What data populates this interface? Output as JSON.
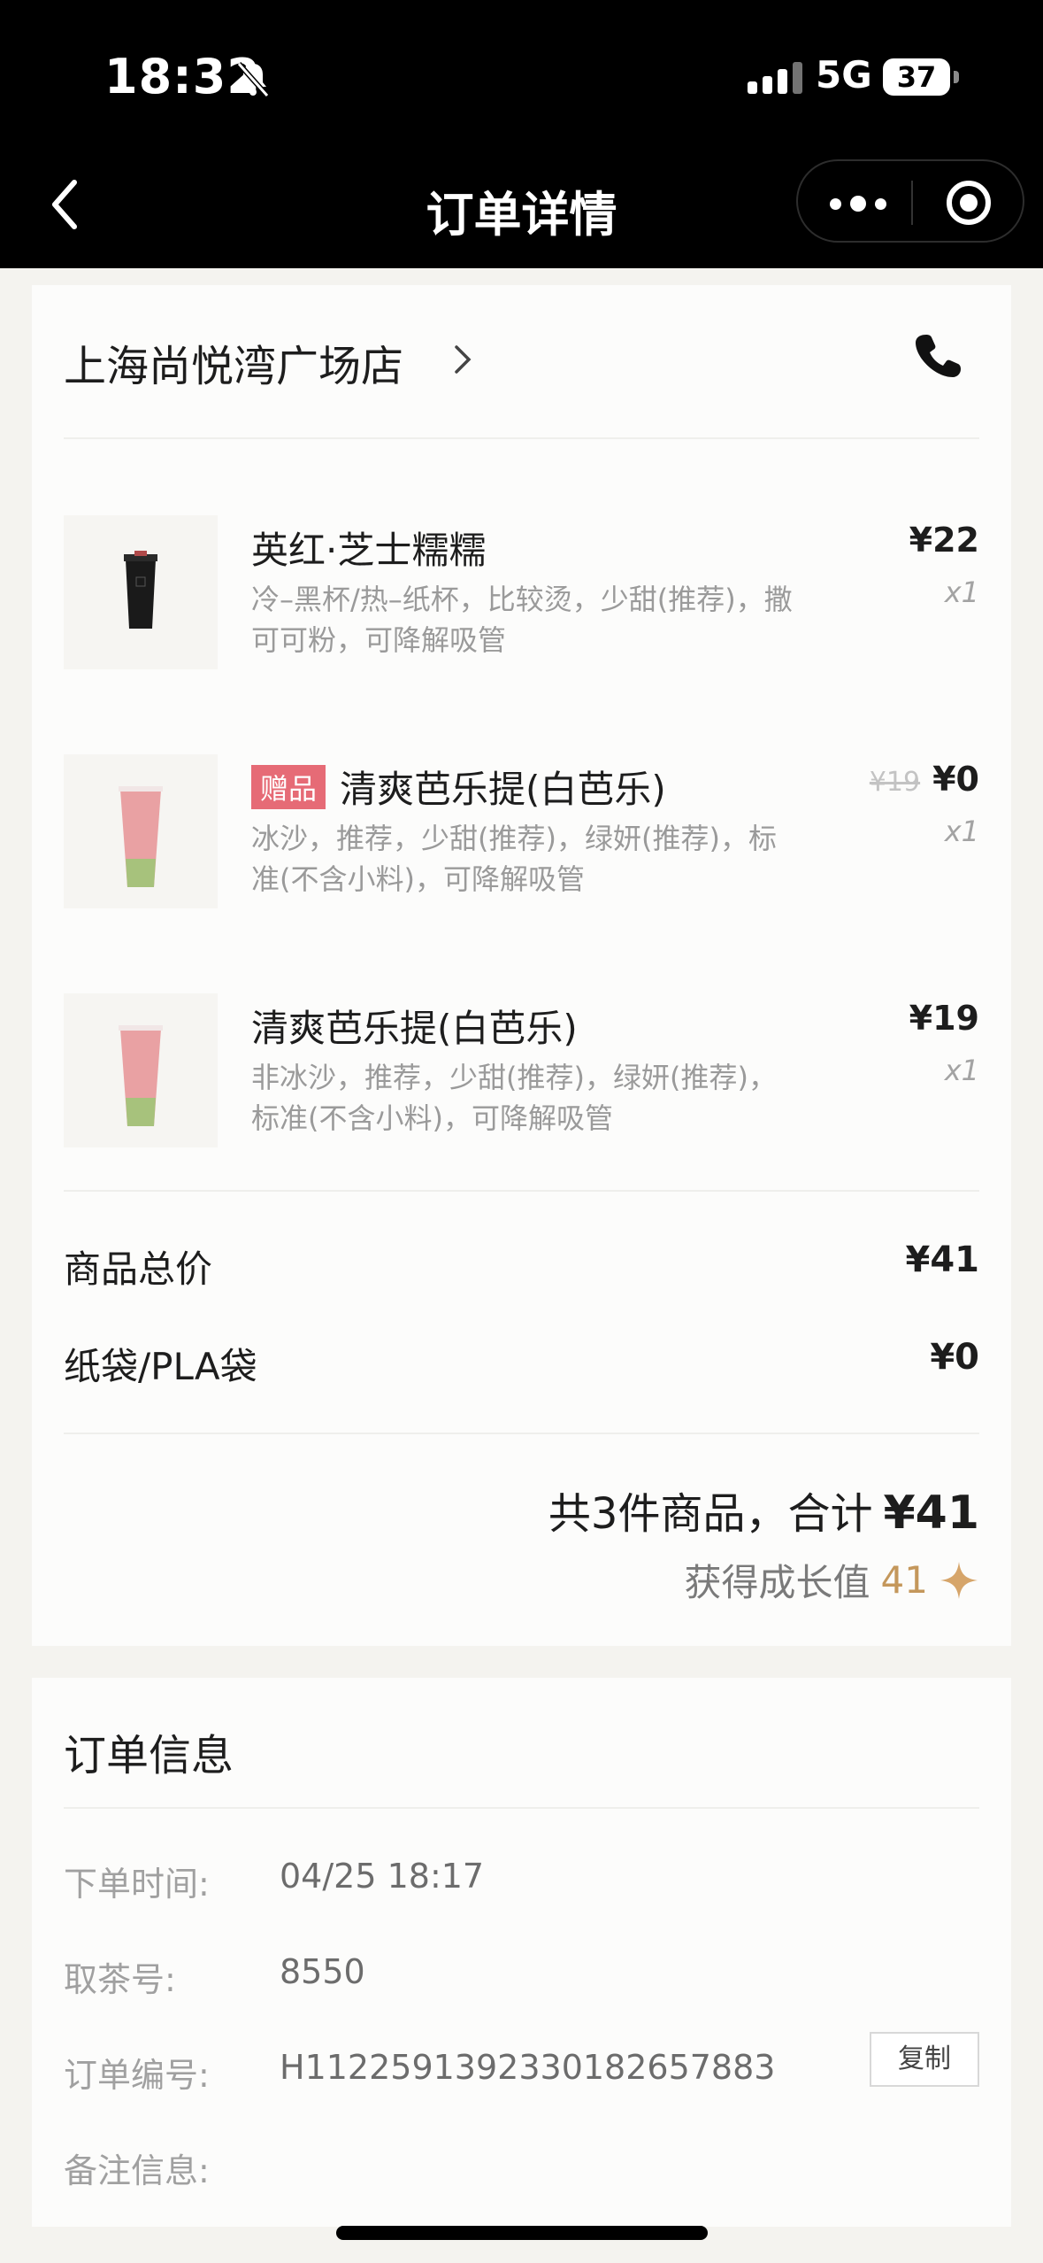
{
  "status_bar": {
    "time": "18:32",
    "network": "5G",
    "battery": "37"
  },
  "nav": {
    "title": "订单详情"
  },
  "store": {
    "name": "上海尚悦湾广场店"
  },
  "items": [
    {
      "name": "英红·芝士糯糯",
      "spec": "冷–黑杯/热–纸杯，比较烫，少甜(推荐)，撒可可粉，可降解吸管",
      "price": "¥22",
      "old_price": "",
      "qty": "x1",
      "gift_tag": "",
      "thumb_color": "#1a1a1a"
    },
    {
      "name": "清爽芭乐提(白芭乐)",
      "spec": "冰沙，推荐，少甜(推荐)，绿妍(推荐)，标准(不含小料)，可降解吸管",
      "price": "¥0",
      "old_price": "¥19",
      "qty": "x1",
      "gift_tag": "赠品",
      "thumb_color": "#e79a9c"
    },
    {
      "name": "清爽芭乐提(白芭乐)",
      "spec": "非冰沙，推荐，少甜(推荐)，绿妍(推荐)，标准(不含小料)，可降解吸管",
      "price": "¥19",
      "old_price": "",
      "qty": "x1",
      "gift_tag": "",
      "thumb_color": "#e79a9c"
    }
  ],
  "summary": {
    "goods_total_label": "商品总价",
    "goods_total": "¥41",
    "bag_label": "纸袋/PLA袋",
    "bag": "¥0",
    "total_text": "共3件商品，合计",
    "total": "¥41",
    "growth_label": "获得成长值",
    "growth": "41"
  },
  "order_info": {
    "title": "订单信息",
    "time_label": "下单时间:",
    "time": "04/25 18:17",
    "pickup_label": "取茶号:",
    "pickup": "8550",
    "order_no_label": "订单编号:",
    "order_no": "H1122591392330182657883",
    "copy_label": "复制",
    "note_label": "备注信息:"
  },
  "colors": {
    "gift_tag": "#e66b76",
    "growth": "#c4975b"
  }
}
